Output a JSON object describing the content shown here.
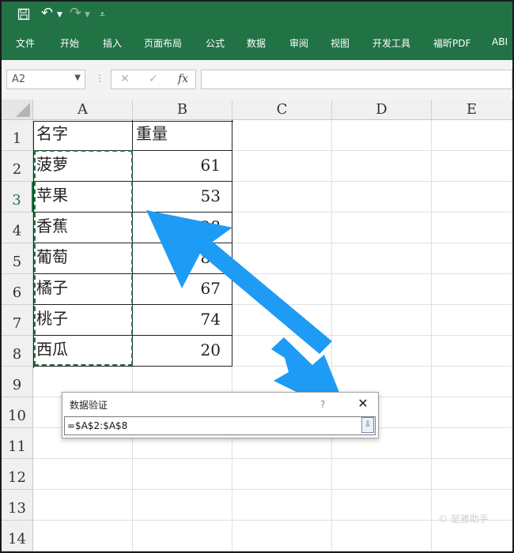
{
  "ribbon": {
    "undo_icon": "↶",
    "redo_icon": "↷",
    "customize_icon": "⩡",
    "tabs": [
      "文件",
      "开始",
      "插入",
      "页面布局",
      "公式",
      "数据",
      "审阅",
      "视图",
      "开发工具",
      "福昕PDF",
      "ABI"
    ]
  },
  "formula_bar": {
    "name_box": "A2",
    "cancel_icon": "✕",
    "enter_icon": "✓",
    "fx_label": "fx",
    "formula": ""
  },
  "sheet": {
    "columns": [
      "A",
      "B",
      "C",
      "D",
      "E"
    ],
    "rows": [
      "1",
      "2",
      "3",
      "4",
      "5",
      "6",
      "7",
      "8",
      "9",
      "10",
      "11",
      "12",
      "13",
      "14"
    ],
    "cells": [
      [
        "名字",
        "重量"
      ],
      [
        "菠萝",
        "61"
      ],
      [
        "苹果",
        "53"
      ],
      [
        "香蕉",
        "28"
      ],
      [
        "葡萄",
        "81"
      ],
      [
        "橘子",
        "67"
      ],
      [
        "桃子",
        "74"
      ],
      [
        "西瓜",
        "20"
      ]
    ]
  },
  "dialog": {
    "title": "数据验证",
    "help": "?",
    "close": "✕",
    "reference": "=$A$2:$A$8",
    "collapse_icon": "⇩"
  },
  "colors": {
    "accent": "#217346",
    "arrow": "#1e9bf5"
  },
  "watermark": "© 是雅助手"
}
